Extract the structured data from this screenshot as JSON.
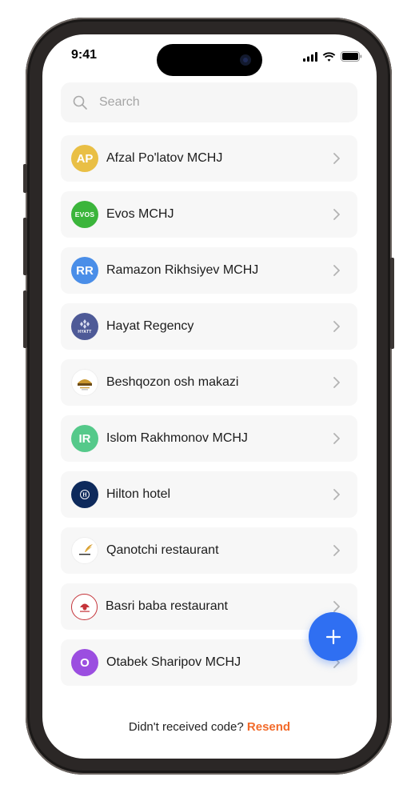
{
  "status_bar": {
    "time": "9:41"
  },
  "search": {
    "placeholder": "Search"
  },
  "items": [
    {
      "name": "Afzal Po'latov MCHJ",
      "initials": "AP",
      "avatar_color": "#e9bf45",
      "logo": "initials"
    },
    {
      "name": "Evos MCHJ",
      "initials": "EVOS",
      "avatar_color": "#3bb53b",
      "logo": "evos"
    },
    {
      "name": "Ramazon Rikhsiyev MCHJ",
      "initials": "RR",
      "avatar_color": "#4a8ee8",
      "logo": "initials"
    },
    {
      "name": "Hayat Regency",
      "initials": "HYATT",
      "avatar_color": "#4e5a97",
      "logo": "hyatt"
    },
    {
      "name": "Beshqozon osh makazi",
      "initials": "",
      "avatar_color": "#ffffff",
      "logo": "beshqozon"
    },
    {
      "name": "Islom Rakhmonov MCHJ",
      "initials": "IR",
      "avatar_color": "#55c98a",
      "logo": "initials"
    },
    {
      "name": "Hilton hotel",
      "initials": "H",
      "avatar_color": "#0e2a5c",
      "logo": "hilton"
    },
    {
      "name": "Qanotchi restaurant",
      "initials": "",
      "avatar_color": "#ffffff",
      "logo": "qanotchi"
    },
    {
      "name": "Basri baba restaurant",
      "initials": "",
      "avatar_color": "#ffffff",
      "logo": "basri"
    },
    {
      "name": "Otabek Sharipov MCHJ",
      "initials": "O",
      "avatar_color": "#9b4ee0",
      "logo": "initials"
    }
  ],
  "footer": {
    "prompt": "Didn't received code?",
    "action": "Resend"
  },
  "colors": {
    "accent": "#2f6ff2",
    "resend": "#f26a2a",
    "row_bg": "#f7f7f7"
  },
  "icons": {
    "search": "search-icon",
    "chevron": "chevron-right-icon",
    "add": "plus-icon"
  }
}
